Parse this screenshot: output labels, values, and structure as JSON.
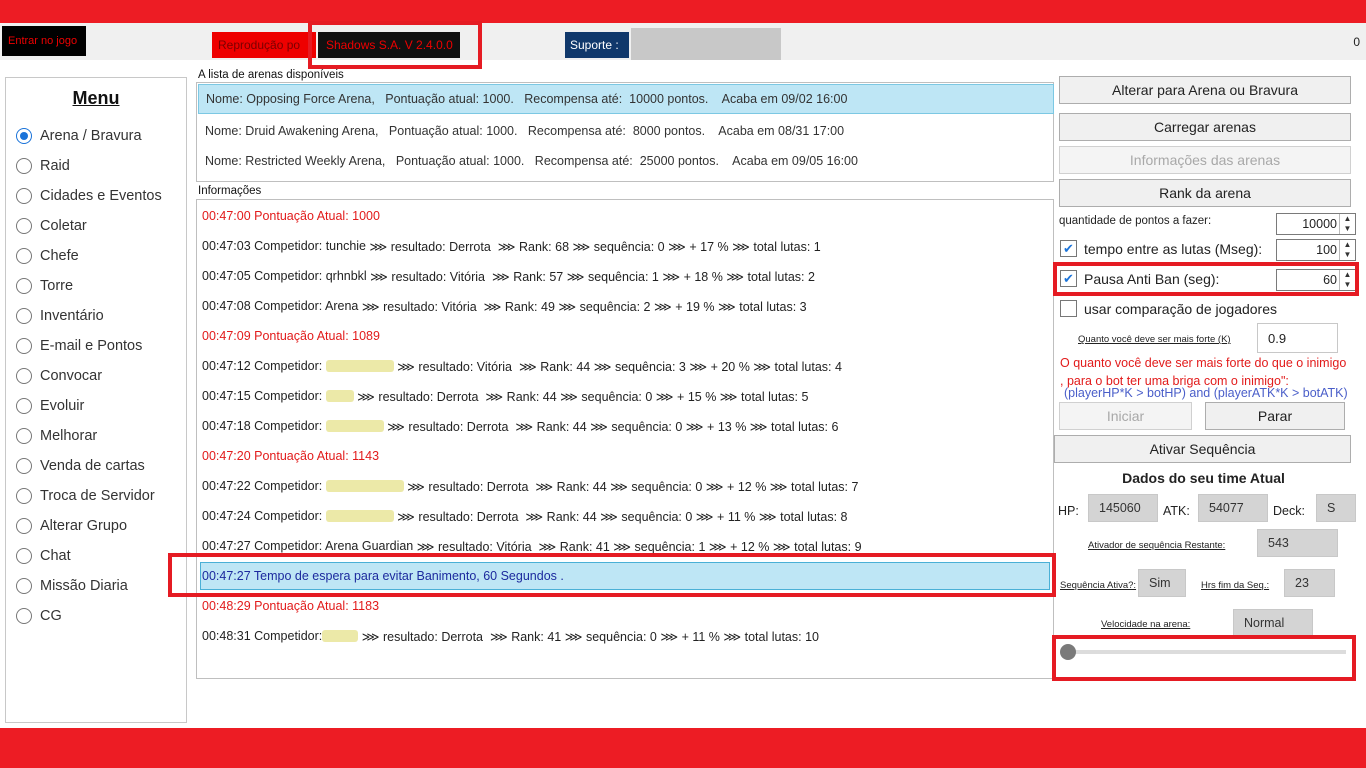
{
  "toolbar": {
    "enter_game": "Entrar no jogo",
    "reproduction_label": "Reprodução po",
    "version": "Shadows S.A. V 2.4.0.0",
    "support_label": "Suporte :",
    "counter": "0"
  },
  "menu": {
    "title": "Menu",
    "items": [
      {
        "label": "Arena / Bravura",
        "selected": true
      },
      {
        "label": "Raid"
      },
      {
        "label": "Cidades e Eventos"
      },
      {
        "label": "Coletar"
      },
      {
        "label": "Chefe"
      },
      {
        "label": "Torre"
      },
      {
        "label": "Inventário"
      },
      {
        "label": "E-mail e Pontos"
      },
      {
        "label": "Convocar"
      },
      {
        "label": "Evoluir"
      },
      {
        "label": "Melhorar"
      },
      {
        "label": "Venda de cartas"
      },
      {
        "label": "Troca de Servidor"
      },
      {
        "label": "Alterar Grupo"
      },
      {
        "label": "Chat"
      },
      {
        "label": "Missão Diaria"
      },
      {
        "label": "CG"
      }
    ]
  },
  "arenas": {
    "label": "A lista de arenas disponíveis",
    "rows": [
      "Nome: Opposing Force Arena,   Pontuação atual: 1000.   Recompensa até:  10000 pontos.    Acaba em 09/02 16:00",
      "Nome: Druid Awakening Arena,   Pontuação atual: 1000.   Recompensa até:  8000 pontos.    Acaba em 08/31 17:00",
      "Nome: Restricted Weekly Arena,   Pontuação atual: 1000.   Recompensa até:  25000 pontos.    Acaba em 09/05 16:00"
    ]
  },
  "info": {
    "label": "Informações",
    "log": [
      {
        "time": "00:47:00",
        "text": " Pontuação Atual: 1000",
        "type": "red"
      },
      {
        "time": "00:47:03",
        "pre": " Competidor: tunchie",
        "post": " ⋙ resultado: Derrota  ⋙ Rank: 68 ⋙ sequência: 0 ⋙ + 17 % ⋙ total lutas: 1",
        "type": "normal"
      },
      {
        "time": "00:47:05",
        "pre": " Competidor: qrhnbkl",
        "post": " ⋙ resultado: Vitória  ⋙ Rank: 57 ⋙ sequência: 1 ⋙ + 18 % ⋙ total lutas: 2",
        "type": "normal"
      },
      {
        "time": "00:47:08",
        "pre": " Competidor: Arena",
        "post": " ⋙ resultado: Vitória  ⋙ Rank: 49 ⋙ sequência: 2 ⋙ + 19 % ⋙ total lutas: 3",
        "type": "normal"
      },
      {
        "time": "00:47:09",
        "text": " Pontuação Atual: 1089",
        "type": "red"
      },
      {
        "time": "00:47:12",
        "pre": " Competidor: ",
        "post": " ⋙ resultado: Vitória  ⋙ Rank: 44 ⋙ sequência: 3 ⋙ + 20 % ⋙ total lutas: 4",
        "type": "normal"
      },
      {
        "time": "00:47:15",
        "pre": " Competidor: ",
        "post": " ⋙ resultado: Derrota  ⋙ Rank: 44 ⋙ sequência: 0 ⋙ + 15 % ⋙ total lutas: 5",
        "type": "normal"
      },
      {
        "time": "00:47:18",
        "pre": " Competidor: ",
        "post": " ⋙ resultado: Derrota  ⋙ Rank: 44 ⋙ sequência: 0 ⋙ + 13 % ⋙ total lutas: 6",
        "type": "normal"
      },
      {
        "time": "00:47:20",
        "text": " Pontuação Atual: 1143",
        "type": "red"
      },
      {
        "time": "00:47:22",
        "pre": " Competidor: ",
        "post": " ⋙ resultado: Derrota  ⋙ Rank: 44 ⋙ sequência: 0 ⋙ + 12 % ⋙ total lutas: 7",
        "type": "normal"
      },
      {
        "time": "00:47:24",
        "pre": " Competidor: ",
        "post": " ⋙ resultado: Derrota  ⋙ Rank: 44 ⋙ sequência: 0 ⋙ + 11 % ⋙ total lutas: 8",
        "type": "normal"
      },
      {
        "time": "00:47:27",
        "pre": " Competidor: Arena Guardian",
        "post": " ⋙ resultado: Vitória  ⋙ Rank: 41 ⋙ sequência: 1 ⋙ + 12 % ⋙ total lutas: 9",
        "type": "normal"
      },
      {
        "time": "00:47:27",
        "text": " Tempo de espera para evitar Banimento, 60 Segundos .",
        "type": "blue"
      },
      {
        "time": "00:48:29",
        "text": " Pontuação Atual: 1183",
        "type": "red"
      },
      {
        "time": "00:48:31",
        "pre": " Competidor:",
        "post": " ⋙ resultado: Derrota  ⋙ Rank: 41 ⋙ sequência: 0 ⋙ + 11 % ⋙ total lutas: 10",
        "type": "normal"
      }
    ]
  },
  "right": {
    "btn_alterar": "Alterar para Arena ou Bravura",
    "btn_carregar": "Carregar arenas",
    "btn_informacoes": "Informações das arenas",
    "btn_rank": "Rank da arena",
    "pontos_label": "quantidade de pontos a fazer:",
    "pontos_value": "10000",
    "tempo_label": "tempo entre as lutas (Mseg):",
    "tempo_value": "100",
    "tempo_checked": true,
    "pausa_label": "Pausa Anti Ban (seg):",
    "pausa_value": "60",
    "pausa_checked": true,
    "comparacao_label": "usar comparação de jogadores",
    "comparacao_checked": false,
    "k_label": "Quanto você deve ser mais forte (K)",
    "k_value": "0.9",
    "desc_red": "O quanto você deve ser mais forte do que o inimigo , para o bot ter uma briga com o inimigo\":",
    "formula": "(playerHP*K > botHP) and (playerATK*K > botATK)",
    "btn_iniciar": "Iniciar",
    "btn_parar": "Parar",
    "btn_ativar": "Ativar Sequência",
    "team_title": "Dados do seu time Atual",
    "hp_label": "HP:",
    "hp_value": "145060",
    "atk_label": "ATK:",
    "atk_value": "54077",
    "deck_label": "Deck:",
    "deck_value": "S",
    "seq_restante_label": "Ativador de sequência Restante:",
    "seq_restante_value": "543",
    "seq_ativa_label": "Sequência Ativa?:",
    "seq_ativa_value": "Sim",
    "hrs_label": "Hrs fim da Seq.:",
    "hrs_value": "23",
    "velocidade_label": "Velocidade na arena:",
    "velocidade_value": "Normal",
    "slider_level": 0
  },
  "colors": {
    "accent_red": "#ed1c24",
    "selection_blue": "#bee6f5",
    "checkbox_blue": "#1a73d9"
  }
}
